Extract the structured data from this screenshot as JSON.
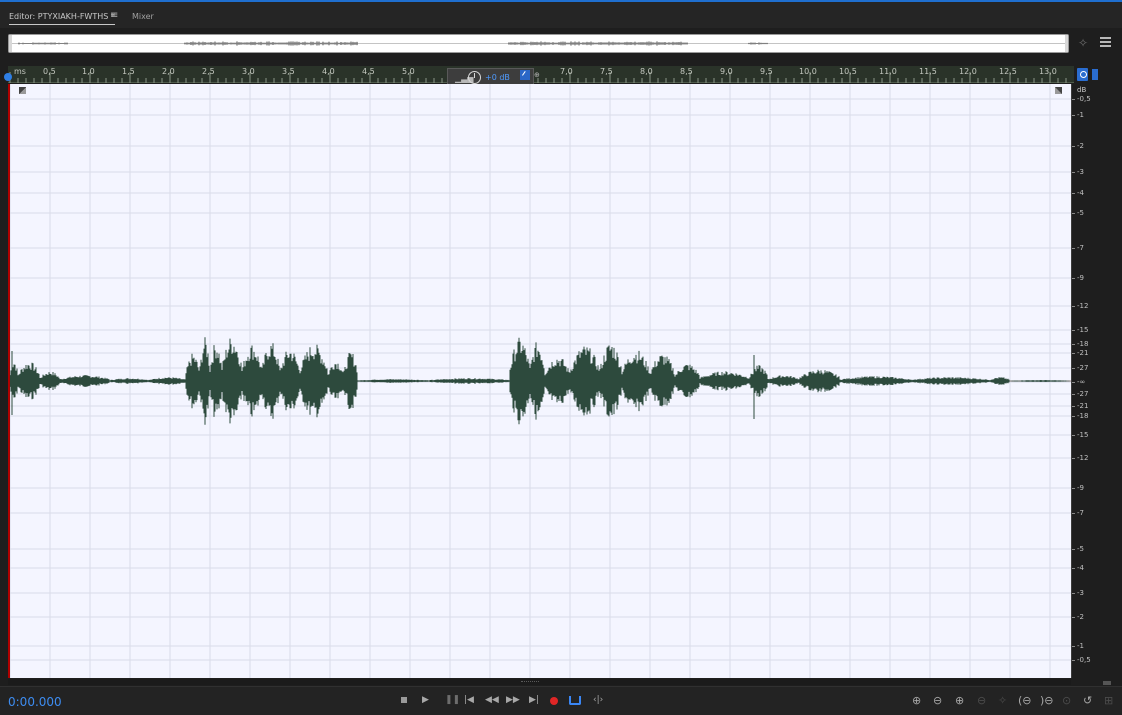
{
  "tabs": {
    "editor_label": "Editor: PTYXIAKH-FWTHS *",
    "menu_glyph": "≡",
    "mixer_label": "Mixer"
  },
  "ruler": {
    "unit": "ms",
    "labels": [
      "0,5",
      "1,0",
      "1,5",
      "2,0",
      "2,5",
      "3,0",
      "3,5",
      "4,0",
      "4,5",
      "5,0",
      "7,0",
      "7,5",
      "8,0",
      "8,5",
      "9,0",
      "9,5",
      "10,0",
      "10,5",
      "11,0",
      "11,5",
      "12,0",
      "12,5",
      "13,0"
    ]
  },
  "hud": {
    "volume": "+0 dB"
  },
  "db_scale": {
    "unit": "dB",
    "labels": [
      "-0,5",
      "-1",
      "-2",
      "-3",
      "-4",
      "-5",
      "-7",
      "-9",
      "-12",
      "-15",
      "-18",
      "-21",
      "-27",
      "-∞",
      "-27",
      "-21",
      "-18",
      "-15",
      "-12",
      "-9",
      "-7",
      "-5",
      "-4",
      "-3",
      "-2",
      "-1",
      "-0,5"
    ]
  },
  "transport": {
    "timecode": "0:00.000"
  },
  "icons": {
    "tab_menu": "hamburger-icon",
    "overview_zoom": "zoom-icon",
    "overview_menu": "list-icon",
    "loop": "loop-icon",
    "record": "record-icon"
  },
  "colors": {
    "waveform": "#2d4a3d",
    "wave_background": "#f4f5ff",
    "accent_blue": "#3a86f4",
    "record_red": "#e02626",
    "playhead_red": "#b00000"
  }
}
